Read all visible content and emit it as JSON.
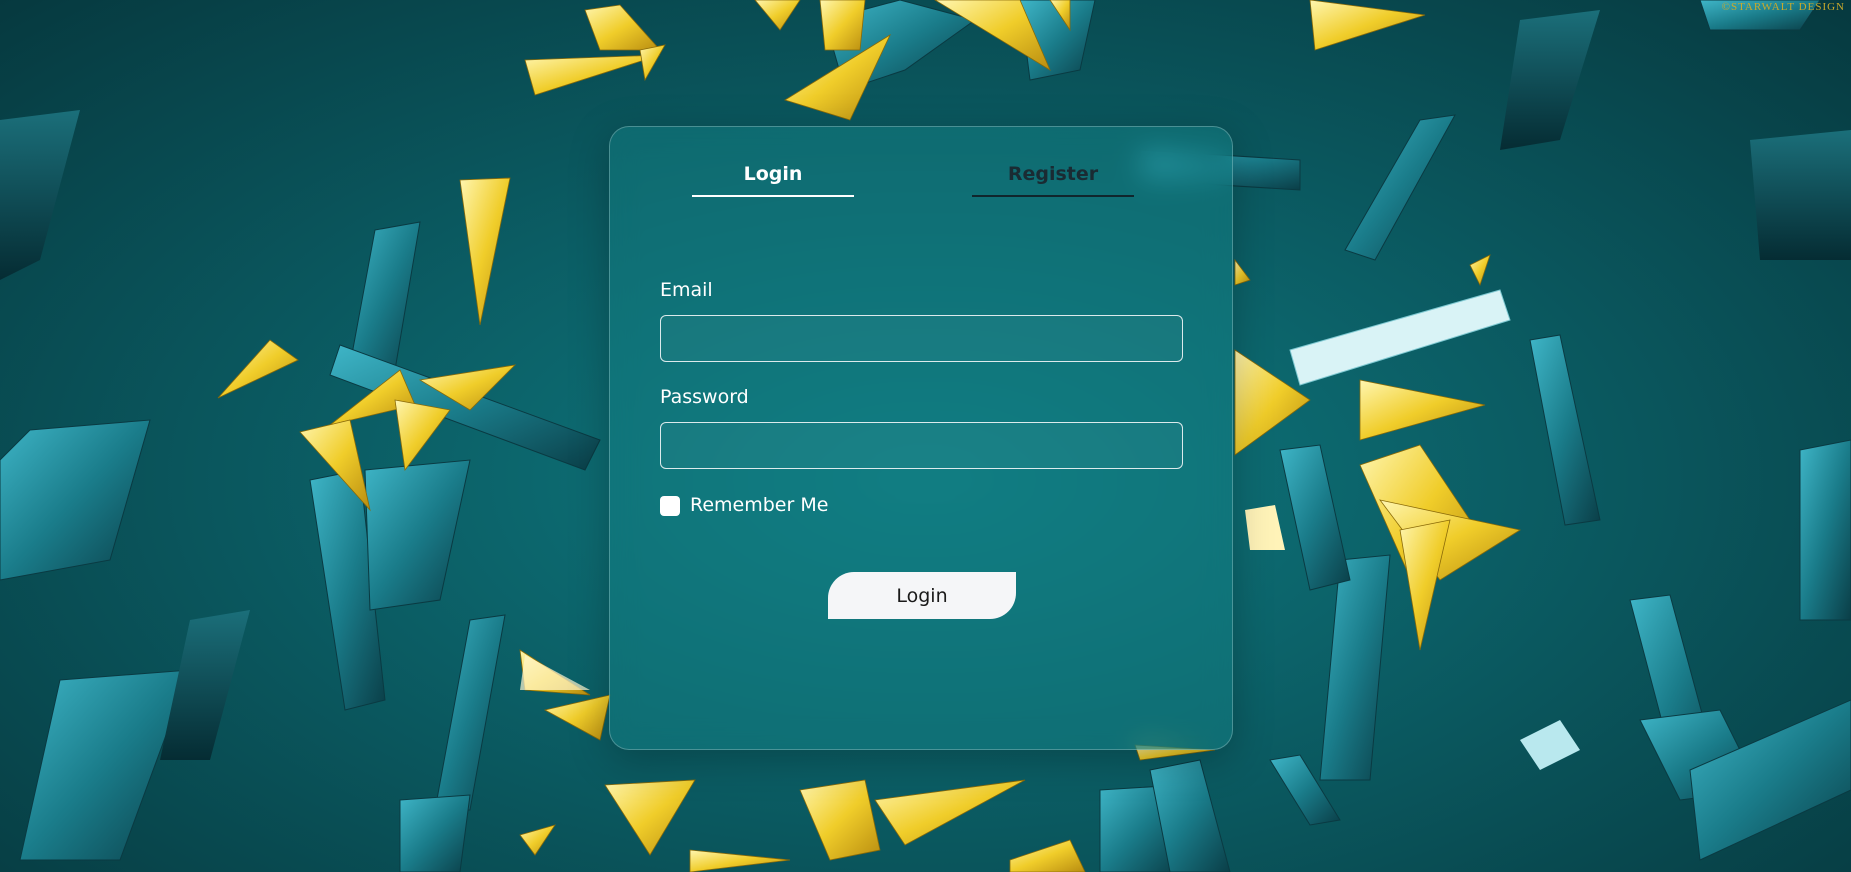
{
  "watermark": "©STARWALT DESIGN",
  "tabs": {
    "login_label": "Login",
    "register_label": "Register"
  },
  "form": {
    "email_label": "Email",
    "email_value": "",
    "email_placeholder": "",
    "password_label": "Password",
    "password_value": "",
    "password_placeholder": "",
    "remember_label": "Remember Me",
    "remember_checked": false,
    "submit_label": "Login"
  },
  "colors": {
    "background": "#0b5d64",
    "card_tint": "#14828a",
    "accent_yellow": "#e8c21f",
    "crystal_teal": "#1b7f8c",
    "text_light": "#ffffff",
    "text_dark": "#1a2b33"
  }
}
